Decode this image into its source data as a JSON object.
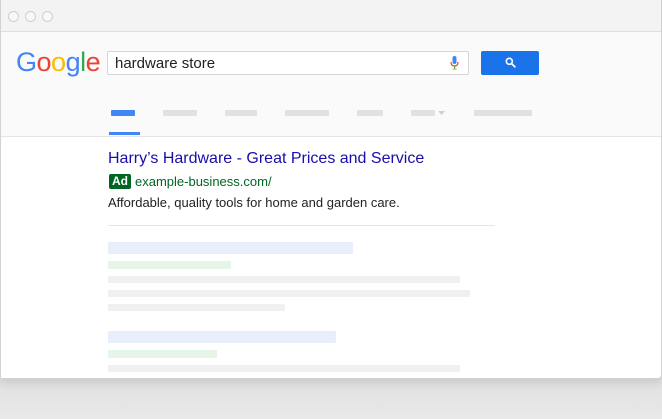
{
  "browser": {
    "title": ""
  },
  "logo": {
    "letters": [
      {
        "char": "G",
        "color": "#4285F4"
      },
      {
        "char": "o",
        "color": "#EA4335"
      },
      {
        "char": "o",
        "color": "#FBBC05"
      },
      {
        "char": "g",
        "color": "#4285F4"
      },
      {
        "char": "l",
        "color": "#34A853"
      },
      {
        "char": "e",
        "color": "#EA4335"
      }
    ]
  },
  "search": {
    "query": "hardware store"
  },
  "ad": {
    "title": "Harry’s Hardware - Great Prices and Service",
    "badge": "Ad",
    "url": "example-business.com/",
    "description": "Affordable, quality tools for home and garden care."
  },
  "colors": {
    "accent": "#4285F4",
    "link": "#1A0DAB",
    "ad_green": "#006621"
  }
}
